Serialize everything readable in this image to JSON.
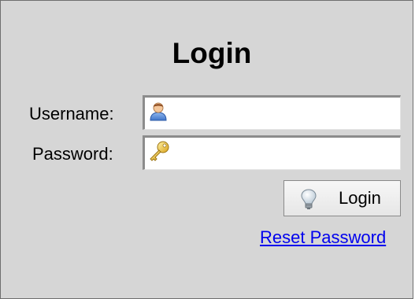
{
  "login_form": {
    "title": "Login",
    "username_label": "Username:",
    "password_label": "Password:",
    "username_value": "",
    "password_value": "",
    "username_icon": "user-icon",
    "password_icon": "key-icon",
    "login_button_label": "Login",
    "login_button_icon": "lightbulb-icon",
    "reset_link_label": "Reset Password"
  },
  "colors": {
    "panel_background": "#d6d6d6",
    "link": "#0000ee"
  }
}
